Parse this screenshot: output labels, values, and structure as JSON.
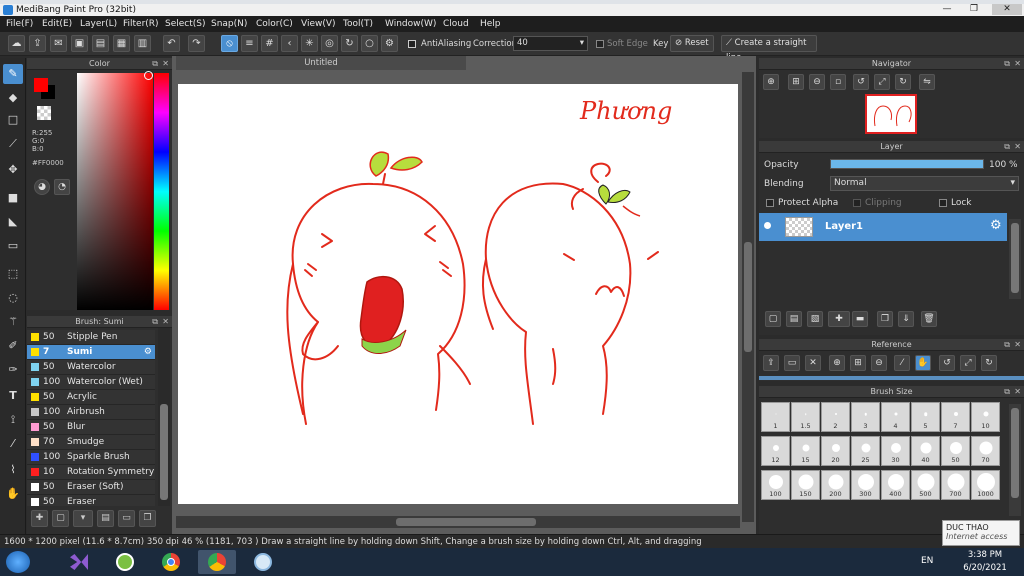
{
  "window": {
    "title": "MediBang Paint Pro (32bit)",
    "min": "—",
    "max": "❐",
    "close": "✕"
  },
  "menu": [
    "File(F)",
    "Edit(E)",
    "Layer(L)",
    "Filter(R)",
    "Select(S)",
    "Snap(N)",
    "Color(C)",
    "View(V)",
    "Tool(T)",
    "Window(W)",
    "Cloud",
    "Help"
  ],
  "toolbar": {
    "antialiasing_label": "AntiAliasing",
    "correction_label": "Correction",
    "correction_value": "40",
    "soft_edge_label": "Soft Edge",
    "key_label": "Key",
    "reset_label": "Reset",
    "straight_line_label": "Create a straight line"
  },
  "color_panel": {
    "title": "Color",
    "r": "R:255",
    "g": "G:0",
    "b": "B:0",
    "hex": "#FF0000",
    "primary_color": "#ff0000",
    "secondary_color": "#000000"
  },
  "brush_panel": {
    "title": "Brush: Sumi",
    "brushes": [
      {
        "size": "50",
        "name": "Stipple Pen",
        "color": "#ffe000"
      },
      {
        "size": "7",
        "name": "Sumi",
        "color": "#ffe000",
        "selected": true
      },
      {
        "size": "50",
        "name": "Watercolor",
        "color": "#7fd3f0"
      },
      {
        "size": "100",
        "name": "Watercolor (Wet)",
        "color": "#7fd3f0"
      },
      {
        "size": "50",
        "name": "Acrylic",
        "color": "#ffe000"
      },
      {
        "size": "100",
        "name": "Airbrush",
        "color": "#c8c8c8"
      },
      {
        "size": "50",
        "name": "Blur",
        "color": "#ff9bd2"
      },
      {
        "size": "70",
        "name": "Smudge",
        "color": "#ffe0c8"
      },
      {
        "size": "100",
        "name": "Sparkle Brush",
        "color": "#3050ff"
      },
      {
        "size": "10",
        "name": "Rotation Symmetry P",
        "color": "#ff2020"
      },
      {
        "size": "50",
        "name": "Eraser (Soft)",
        "color": "#ffffff"
      },
      {
        "size": "50",
        "name": "Eraser",
        "color": "#ffffff"
      }
    ]
  },
  "canvas": {
    "tab_title": "Untitled",
    "signature": "Phương"
  },
  "navigator": {
    "title": "Navigator"
  },
  "layer_panel": {
    "title": "Layer",
    "opacity_label": "Opacity",
    "opacity_value": "100 %",
    "opacity_fraction": 1.0,
    "blending_label": "Blending",
    "blending_value": "Normal",
    "protect_alpha": "Protect Alpha",
    "clipping": "Clipping",
    "lock": "Lock",
    "layers": [
      {
        "name": "Layer1"
      }
    ]
  },
  "reference_panel": {
    "title": "Reference"
  },
  "brush_size_panel": {
    "title": "Brush Size",
    "sizes": [
      "1",
      "1.5",
      "2",
      "3",
      "4",
      "5",
      "7",
      "10",
      "12",
      "15",
      "20",
      "25",
      "30",
      "40",
      "50",
      "70",
      "100",
      "150",
      "200",
      "300",
      "400",
      "500",
      "700",
      "1000"
    ]
  },
  "status": {
    "text": "1600 * 1200 pixel   (11.6 * 8.7cm)   350 dpi   46 %   (1181, 703 )   Draw a straight line by holding down Shift, Change a brush size by holding down Ctrl, Alt, and dragging"
  },
  "taskbar": {
    "lang": "EN",
    "time": "3:38 PM",
    "date": "6/20/2021"
  },
  "tooltip": {
    "line1": "DUC THAO",
    "line2": "Internet access"
  }
}
